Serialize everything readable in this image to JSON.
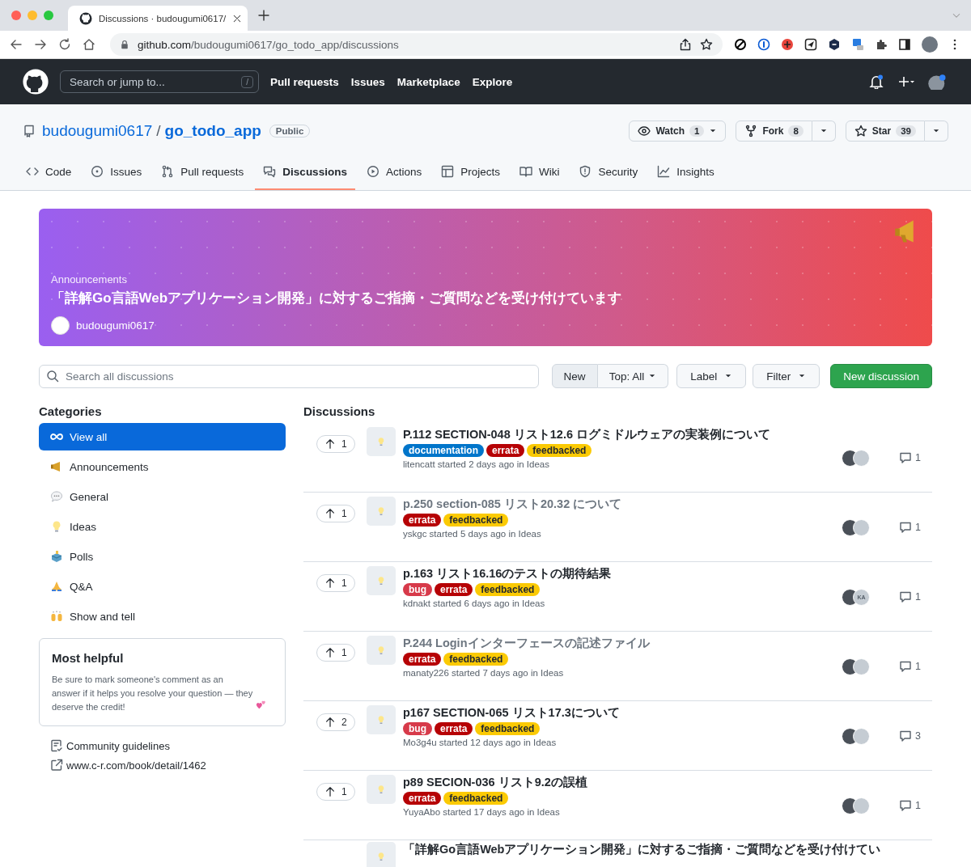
{
  "browser": {
    "tab_title": "Discussions · budougumi0617/",
    "url_host": "github.com",
    "url_path": "/budougumi0617/go_todo_app/discussions"
  },
  "header": {
    "search_placeholder": "Search or jump to...",
    "slash_key": "/",
    "nav": [
      "Pull requests",
      "Issues",
      "Marketplace",
      "Explore"
    ]
  },
  "repo": {
    "owner": "budougumi0617",
    "separator": "/",
    "name": "go_todo_app",
    "visibility": "Public",
    "actions": [
      {
        "kind": "watch",
        "label": "Watch",
        "count": "1"
      },
      {
        "kind": "fork",
        "label": "Fork",
        "count": "8"
      },
      {
        "kind": "star",
        "label": "Star",
        "count": "39"
      }
    ]
  },
  "tabs": [
    {
      "kind": "code",
      "label": "Code",
      "selected": false
    },
    {
      "kind": "issues",
      "label": "Issues",
      "selected": false
    },
    {
      "kind": "pulls",
      "label": "Pull requests",
      "selected": false
    },
    {
      "kind": "discussions",
      "label": "Discussions",
      "selected": true
    },
    {
      "kind": "actions",
      "label": "Actions",
      "selected": false
    },
    {
      "kind": "projects",
      "label": "Projects",
      "selected": false
    },
    {
      "kind": "wiki",
      "label": "Wiki",
      "selected": false
    },
    {
      "kind": "security",
      "label": "Security",
      "selected": false
    },
    {
      "kind": "insights",
      "label": "Insights",
      "selected": false
    }
  ],
  "banner": {
    "category": "Announcements",
    "title": "「詳解Go言語Webアプリケーション開発」に対するご指摘・ご質問などを受け付けています",
    "author": "budougumi0617"
  },
  "toolbar": {
    "search_placeholder": "Search all discussions",
    "sort": [
      {
        "label": "New",
        "selected": true
      },
      {
        "label": "Top: All",
        "selected": false
      }
    ],
    "label_button": "Label",
    "filter_button": "Filter",
    "new_button": "New discussion"
  },
  "categories": {
    "heading": "Categories",
    "items": [
      {
        "kind": "all",
        "label": "View all",
        "selected": true
      },
      {
        "kind": "announcements",
        "label": "Announcements",
        "selected": false
      },
      {
        "kind": "general",
        "label": "General",
        "selected": false
      },
      {
        "kind": "ideas",
        "label": "Ideas",
        "selected": false
      },
      {
        "kind": "polls",
        "label": "Polls",
        "selected": false
      },
      {
        "kind": "qa",
        "label": "Q&A",
        "selected": false
      },
      {
        "kind": "show",
        "label": "Show and tell",
        "selected": false
      }
    ]
  },
  "helpful": {
    "title": "Most helpful",
    "text": "Be sure to mark someone's comment as an answer if it helps you resolve your question — they deserve the credit!"
  },
  "links": [
    {
      "kind": "guidelines",
      "label": "Community guidelines"
    },
    {
      "kind": "external",
      "label": "www.c-r.com/book/detail/1462"
    }
  ],
  "discussions": {
    "heading": "Discussions",
    "items": [
      {
        "votes": "1",
        "title": "P.112 SECTION-048 リスト12.6 ログミドルウェアの実装例について",
        "read": false,
        "labels": [
          {
            "name": "documentation",
            "color": "#0075ca"
          },
          {
            "name": "errata",
            "color": "#b60205"
          },
          {
            "name": "feedbacked",
            "color": "#fbca04"
          }
        ],
        "meta": "litencatt started 2 days ago in Ideas",
        "comments": "1"
      },
      {
        "votes": "1",
        "title": "p.250 section-085 リスト20.32 について",
        "read": true,
        "labels": [
          {
            "name": "errata",
            "color": "#b60205"
          },
          {
            "name": "feedbacked",
            "color": "#fbca04"
          }
        ],
        "meta": "yskgc started 5 days ago in Ideas",
        "comments": "1"
      },
      {
        "votes": "1",
        "title": "p.163 リスト16.16のテストの期待結果",
        "read": false,
        "labels": [
          {
            "name": "bug",
            "color": "#d73a4a"
          },
          {
            "name": "errata",
            "color": "#b60205"
          },
          {
            "name": "feedbacked",
            "color": "#fbca04"
          }
        ],
        "meta": "kdnakt started 6 days ago in Ideas",
        "comments": "1",
        "avatar_initials": "KA"
      },
      {
        "votes": "1",
        "title": "P.244 Loginインターフェースの記述ファイル",
        "read": true,
        "labels": [
          {
            "name": "errata",
            "color": "#b60205"
          },
          {
            "name": "feedbacked",
            "color": "#fbca04"
          }
        ],
        "meta": "manaty226 started 7 days ago in Ideas",
        "comments": "1"
      },
      {
        "votes": "2",
        "title": "p167 SECTION-065 リスト17.3について",
        "read": false,
        "labels": [
          {
            "name": "bug",
            "color": "#d73a4a"
          },
          {
            "name": "errata",
            "color": "#b60205"
          },
          {
            "name": "feedbacked",
            "color": "#fbca04"
          }
        ],
        "meta": "Mo3g4u started 12 days ago in Ideas",
        "comments": "3"
      },
      {
        "votes": "1",
        "title": "p89 SECION-036 リスト9.2の誤植",
        "read": false,
        "labels": [
          {
            "name": "errata",
            "color": "#b60205"
          },
          {
            "name": "feedbacked",
            "color": "#fbca04"
          }
        ],
        "meta": "YuyaAbo started 17 days ago in Ideas",
        "comments": "1"
      },
      {
        "title": "「詳解Go言語Webアプリケーション開発」に対するご指摘・ご質問などを受け付けてい"
      }
    ]
  }
}
